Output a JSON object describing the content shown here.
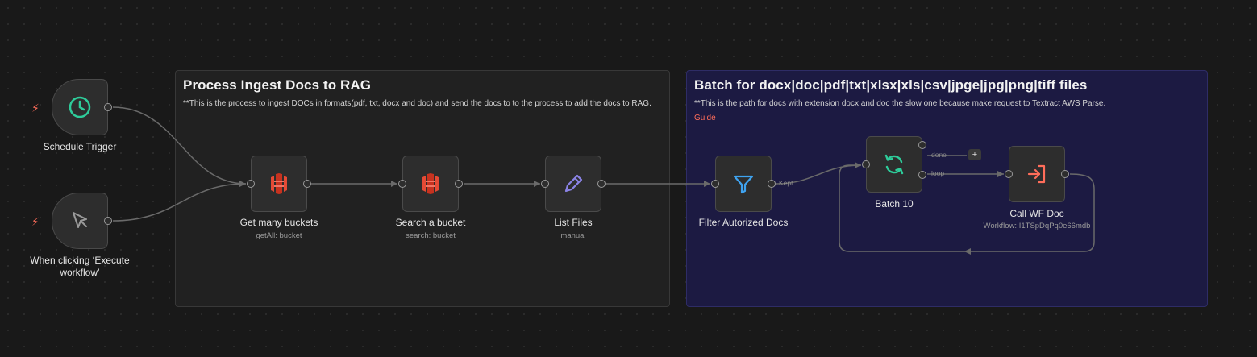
{
  "stickies": [
    {
      "title": "Process Ingest Docs to RAG",
      "body": "**This is the process to ingest DOCs in formats(pdf, txt, docx and doc) and send the docs to to the process to add the docs to RAG."
    },
    {
      "title": "Batch for docx|doc|pdf|txt|xlsx|xls|csv|jpge|jpg|png|tiff files",
      "body": "**This is the path for docs with extension docx and doc the slow one because make request to Textract AWS Parse.",
      "link": "Guide"
    }
  ],
  "nodes": {
    "schedule_trigger": {
      "label": "Schedule Trigger",
      "icon": "clock-icon",
      "color": "#2ecc9a"
    },
    "manual_trigger": {
      "label": "When clicking ‘Execute workflow’",
      "icon": "cursor-icon",
      "color": "#9a9a9a"
    },
    "get_many_buckets": {
      "label": "Get many buckets",
      "sub": "getAll: bucket",
      "icon": "aws-s3-icon",
      "color": "#e64a35"
    },
    "search_bucket": {
      "label": "Search a bucket",
      "sub": "search: bucket",
      "icon": "aws-s3-icon",
      "color": "#e64a35"
    },
    "list_files": {
      "label": "List Files",
      "sub": "manual",
      "icon": "pencil-icon",
      "color": "#8b83e6"
    },
    "filter": {
      "label": "Filter Autorized Docs",
      "icon": "filter-icon",
      "color": "#3fa3f0"
    },
    "batch": {
      "label": "Batch 10",
      "icon": "loop-icon",
      "color": "#2ecc9a"
    },
    "call_wf": {
      "label": "Call WF Doc",
      "sub": "Workflow: I1TSpDqPq0e66mdb",
      "icon": "execute-workflow-icon",
      "color": "#ff6d5a"
    }
  },
  "edge_labels": {
    "kept": "Kept",
    "done": "done",
    "loop": "loop"
  },
  "add_button": "+",
  "trigger_bolt": "⚡"
}
